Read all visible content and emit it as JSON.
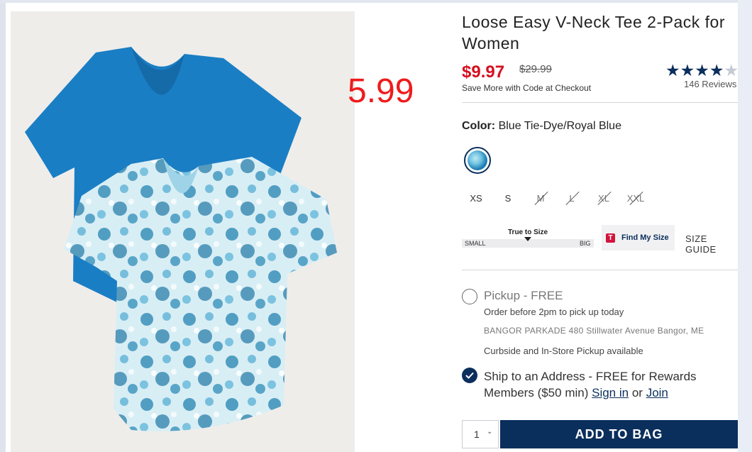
{
  "annotation": "5.99",
  "product": {
    "title": "Loose Easy V-Neck Tee 2-Pack for Women",
    "price": "$9.97",
    "original_price": "$29.99",
    "promo_text": "Save More with Code at Checkout",
    "rating": 4.5,
    "stars": "★★★★",
    "half_star": "★",
    "reviews": "146 Reviews"
  },
  "color": {
    "label": "Color:",
    "value": "Blue Tie-Dye/Royal Blue"
  },
  "sizes": [
    {
      "label": "XS",
      "available": true
    },
    {
      "label": "S",
      "available": true
    },
    {
      "label": "M",
      "available": false
    },
    {
      "label": "L",
      "available": false
    },
    {
      "label": "XL",
      "available": false
    },
    {
      "label": "XXL",
      "available": false
    }
  ],
  "fit": {
    "label": "True to Size",
    "small": "SMALL",
    "big": "BIG"
  },
  "find_my_size": {
    "icon": "T",
    "label": "Find My Size"
  },
  "size_guide": "SIZE GUIDE",
  "fulfillment": {
    "pickup": "Pickup - FREE",
    "order_before": "Order before 2pm to pick up today",
    "store": "BANGOR PARKADE 480 Stillwater Avenue  Bangor, ME",
    "curbside": "Curbside and In-Store Pickup available",
    "ship_text": "Ship to an Address - FREE for Rewards Members ($50 min)",
    "sign_in": "Sign in",
    "or": "or",
    "join": "Join"
  },
  "quantity": {
    "value": "1",
    "chevron": "⌄"
  },
  "add_to_bag": "ADD TO BAG",
  "colors": {
    "navy": "#0b2f5c",
    "sale_red": "#d50f1f",
    "annotation_red": "#ee1c1c"
  }
}
